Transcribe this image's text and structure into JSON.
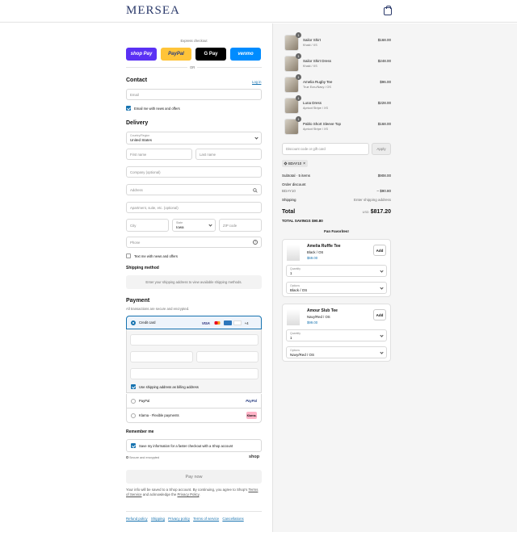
{
  "header": {
    "logo": "MERSEA",
    "cart_icon": "bag-icon"
  },
  "express": {
    "label": "Express checkout",
    "buttons": [
      {
        "label": "shop Pay",
        "bg": "#5a31f4",
        "fg": "#ffffff"
      },
      {
        "label": "PayPal",
        "bg": "#ffc439",
        "fg": "#253b80"
      },
      {
        "label": "G Pay",
        "bg": "#000000",
        "fg": "#ffffff"
      },
      {
        "label": "venmo",
        "bg": "#008cff",
        "fg": "#ffffff"
      }
    ],
    "or": "OR"
  },
  "contact": {
    "title": "Contact",
    "login": "Log in",
    "email_placeholder": "Email",
    "news_label": "Email me with news and offers"
  },
  "delivery": {
    "title": "Delivery",
    "country_label": "Country/Region",
    "country_value": "United States",
    "first_name": "First name",
    "last_name": "Last name",
    "company": "Company (optional)",
    "address": "Address",
    "apartment": "Apartment, suite, etc. (optional)",
    "city": "City",
    "state_label": "State",
    "state_value": "Iowa",
    "zip": "ZIP code",
    "phone": "Phone",
    "text_label": "Text me with news and offers"
  },
  "shipping": {
    "title": "Shipping method",
    "note": "Enter your shipping address to view available shipping methods."
  },
  "payment": {
    "title": "Payment",
    "subtitle": "All transactions are secure and encrypted.",
    "credit_card": "Credit card",
    "more_cards": "+4",
    "billing_label": "Use shipping address as billing address",
    "paypal": "PayPal",
    "paypal_logo": "PayPal",
    "klarna": "Klarna - Flexible payments",
    "klarna_logo": "Klarna."
  },
  "remember": {
    "title": "Remember me",
    "save_label": "Save my information for a faster checkout with a Shop account",
    "secure": "Secure and encrypted",
    "shop": "shop"
  },
  "pay_now": "Pay now",
  "legal": {
    "text1": "Your info will be saved to a Shop account. By continuing, you agree to Shop's",
    "terms": "Terms of Service",
    "text2": "and acknowledge the",
    "privacy": "Privacy Policy",
    "period": "."
  },
  "footer_links": [
    "Refund policy",
    "Shipping",
    "Privacy policy",
    "Terms of service",
    "Cancellations"
  ],
  "cart": {
    "items": [
      {
        "name": "Sailor Shirt",
        "variant": "Khaki / XS",
        "price": "$168.00",
        "qty": "1"
      },
      {
        "name": "Sailor Shirt Dress",
        "variant": "Khaki / XS",
        "price": "$248.00",
        "qty": "1"
      },
      {
        "name": "Amelia Rugby Tee",
        "variant": "True Ecru/Navy / OS",
        "price": "$96.00",
        "qty": "1"
      },
      {
        "name": "Luna Dress",
        "variant": "Apricot Stripe / XS",
        "price": "$228.00",
        "qty": "1"
      },
      {
        "name": "Pablo Short Sleeve Top",
        "variant": "Apricot Stripe / XS",
        "price": "$168.00",
        "qty": "1"
      }
    ],
    "discount_placeholder": "Discount code or gift card",
    "apply": "Apply",
    "code_chip": "BDAY10",
    "subtotal_label": "Subtotal · 5 items",
    "subtotal_value": "$908.00",
    "order_discount": "Order discount",
    "discount_code": "BDAY10",
    "discount_value": "– $90.80",
    "shipping_label": "Shipping",
    "shipping_value": "Enter shipping address",
    "total_label": "Total",
    "currency": "USD",
    "total_value": "$817.20",
    "savings_label": "TOTAL SAVINGS",
    "savings_value": "$90.80"
  },
  "favorites": {
    "title": "Fan Favorites!",
    "items": [
      {
        "name": "Amelia Ruffle Tee",
        "variant": "Black / OS",
        "price": "$69.00",
        "add": "Add",
        "qty_label": "Quantity",
        "qty_value": "1",
        "opt_label": "Options",
        "opt_value": "Black / OS"
      },
      {
        "name": "Amour Slub Tee",
        "variant": "Navy/Red / OS",
        "price": "$99.00",
        "add": "Add",
        "qty_label": "Quantity",
        "qty_value": "1",
        "opt_label": "Options",
        "opt_value": "Navy/Red / OS"
      }
    ]
  },
  "colors": {
    "brand": "#2b3a6b",
    "accent": "#1773b0"
  }
}
